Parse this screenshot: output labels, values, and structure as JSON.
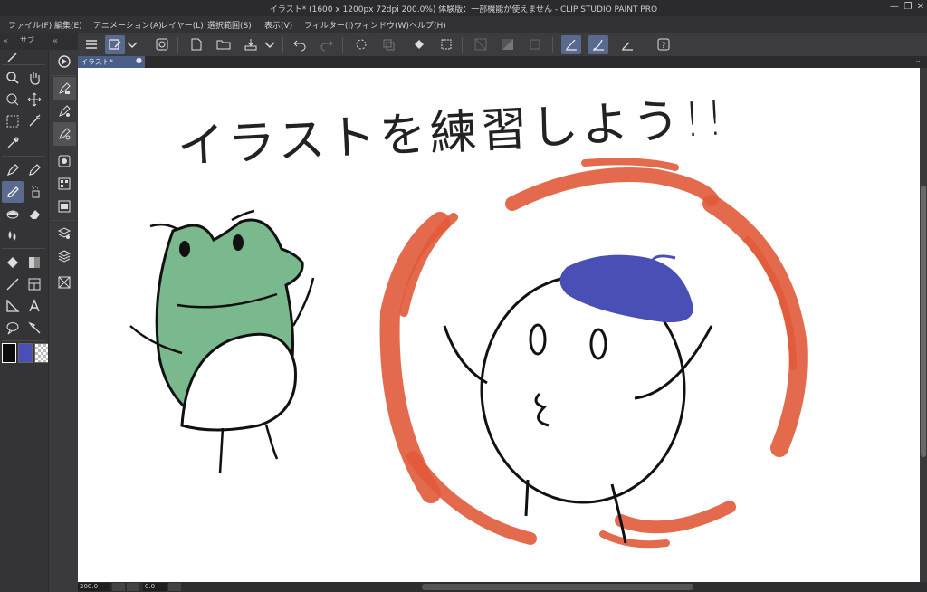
{
  "window": {
    "title": "イラスト* (1600 x 1200px 72dpi 200.0%)  体験版：一部機能が使えません - CLIP STUDIO PAINT PRO"
  },
  "menu": [
    "ファイル(F)",
    "編集(E)",
    "アニメーション(A)",
    "レイヤー(L)",
    "選択範囲(S)",
    "表示(V)",
    "フィルター(I)",
    "ウィンドウ(W)",
    "ヘルプ(H)"
  ],
  "left_panel": {
    "tab_label": "サブ"
  },
  "canvas": {
    "tab_label": "イラスト*",
    "heading_text": "イラストを練習しよう!!"
  },
  "colors": {
    "main": "#0d0d0d",
    "sub": "#4a4fb6",
    "transparent": "checker",
    "frog_green": "#7ab88e",
    "beret": "#4a4fb6",
    "swirl": "#e15a3a"
  },
  "status": {
    "zoom": "200.0",
    "angle": "0.0"
  }
}
